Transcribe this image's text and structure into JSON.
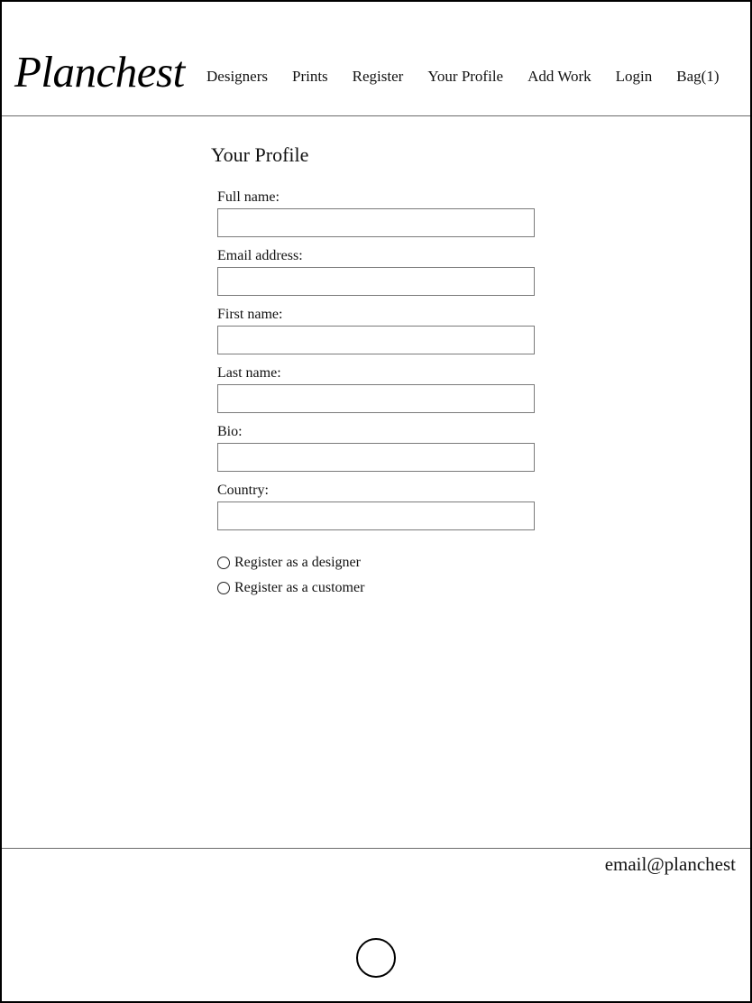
{
  "header": {
    "logo": "Planchest",
    "nav": [
      {
        "label": "Designers"
      },
      {
        "label": "Prints"
      },
      {
        "label": "Register"
      },
      {
        "label": "Your Profile"
      },
      {
        "label": "Add Work"
      },
      {
        "label": "Login"
      },
      {
        "label": "Bag(1)"
      }
    ]
  },
  "main": {
    "title": "Your Profile",
    "fields": [
      {
        "label": "Full name:",
        "value": ""
      },
      {
        "label": "Email address:",
        "value": ""
      },
      {
        "label": "First name:",
        "value": ""
      },
      {
        "label": "Last name:",
        "value": ""
      },
      {
        "label": "Bio:",
        "value": ""
      },
      {
        "label": "Country:",
        "value": ""
      }
    ],
    "radios": [
      {
        "label": "Register as a designer",
        "checked": false
      },
      {
        "label": "Register as a customer",
        "checked": false
      }
    ]
  },
  "footer": {
    "email": "email@planchest"
  },
  "device": {
    "home_button_icon": "home-button-circle"
  }
}
